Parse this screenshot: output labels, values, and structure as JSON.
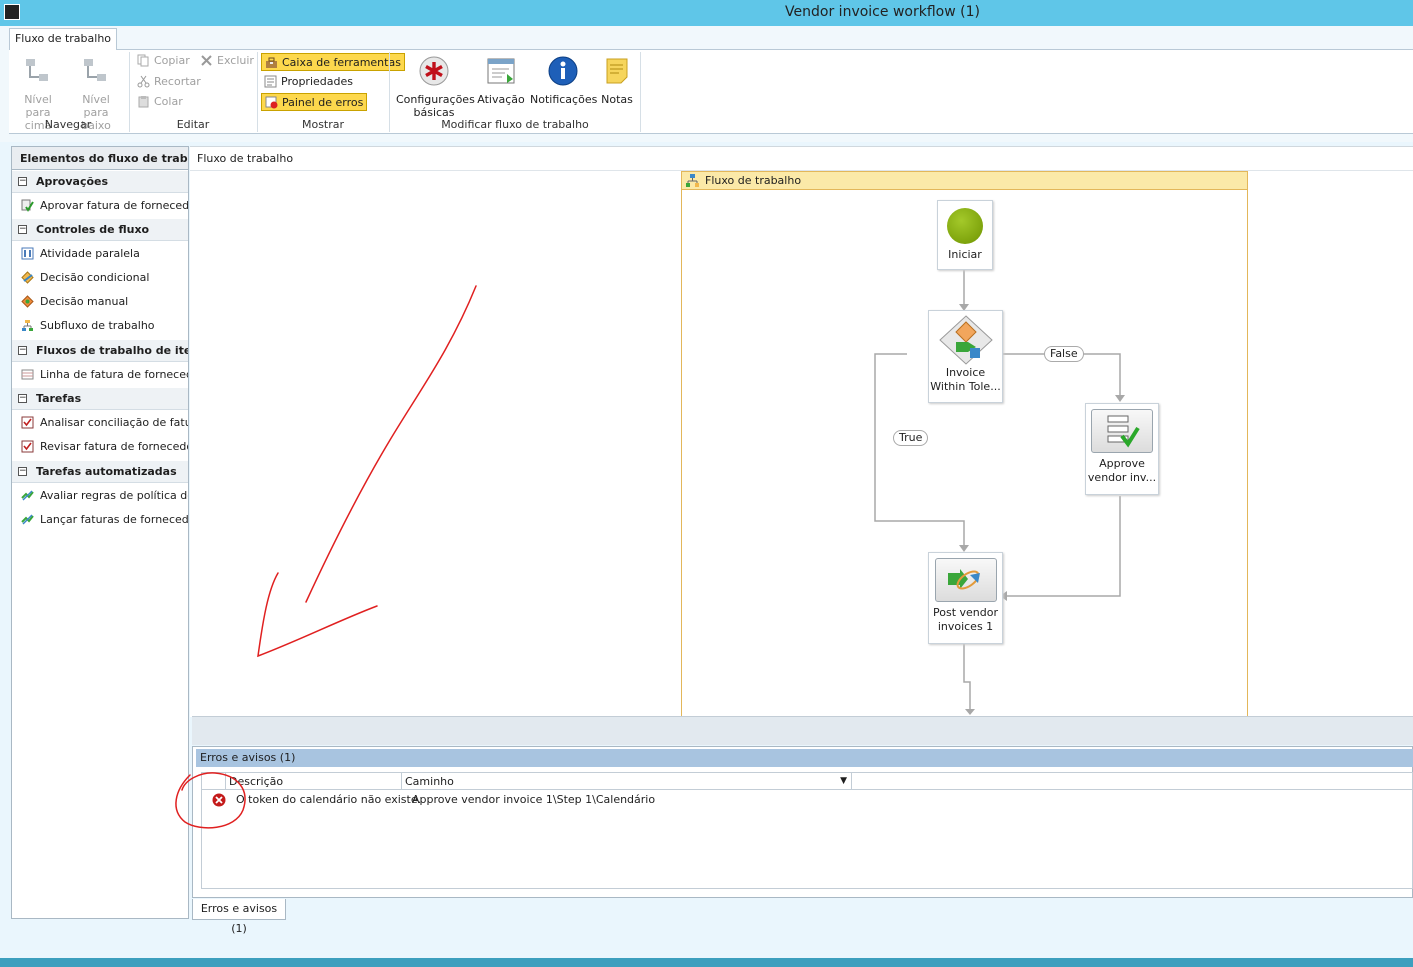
{
  "window": {
    "title": "Vendor invoice workflow (1)"
  },
  "ribbon": {
    "tab": "Fluxo de trabalho",
    "groups": {
      "navegar": {
        "label": "Navegar",
        "up": [
          "Nível para",
          "cima"
        ],
        "down": [
          "Nível para",
          "baixo"
        ]
      },
      "editar": {
        "label": "Editar",
        "copy": "Copiar",
        "delete": "Excluir",
        "cut": "Recortar",
        "paste": "Colar"
      },
      "mostrar": {
        "label": "Mostrar",
        "toolbox": "Caixa de ferramentas",
        "properties": "Propriedades",
        "error_pane": "Painel de erros"
      },
      "modificar": {
        "label": "Modificar fluxo de trabalho",
        "basic": [
          "Configurações",
          "básicas"
        ],
        "activation": "Ativação",
        "notifications": "Notificações",
        "notes": "Notas"
      }
    }
  },
  "sidebar": {
    "title": "Elementos do fluxo de trabalho",
    "categories": [
      {
        "name": "Aprovações",
        "items": [
          "Aprovar fatura de fornecedor"
        ]
      },
      {
        "name": "Controles de fluxo",
        "items": [
          "Atividade paralela",
          "Decisão condicional",
          "Decisão manual",
          "Subfluxo de trabalho"
        ]
      },
      {
        "name": "Fluxos de trabalho de item de",
        "items": [
          "Linha de fatura de fornecedor"
        ]
      },
      {
        "name": "Tarefas",
        "items": [
          "Analisar conciliação de faturas",
          "Revisar fatura de fornecedor"
        ]
      },
      {
        "name": "Tarefas automatizadas",
        "items": [
          "Avaliar regras de política de fa",
          "Lançar faturas de fornecedor"
        ]
      }
    ]
  },
  "canvas": {
    "breadcrumb": "Fluxo de trabalho",
    "container_title": "Fluxo de trabalho",
    "nodes": {
      "start": "Iniciar",
      "decision": [
        "Invoice",
        "Within Tole..."
      ],
      "approve": [
        "Approve",
        "vendor inv..."
      ],
      "post": [
        "Post vendor",
        "invoices 1"
      ]
    },
    "edges": {
      "true_label": "True",
      "false_label": "False"
    }
  },
  "errors": {
    "title": "Erros e avisos (1)",
    "columns": [
      "Descrição",
      "Caminho"
    ],
    "rows": [
      {
        "description": "O token do calendário não existe.",
        "path": "Approve vendor invoice 1\\Step 1\\Calendário"
      }
    ],
    "tab_label": "Erros e avisos (1)"
  },
  "colors": {
    "titlebar": "#5fc6e8",
    "highlight": "#fdd84d",
    "annotation": "#e02020",
    "start_node": "#7aa300"
  }
}
